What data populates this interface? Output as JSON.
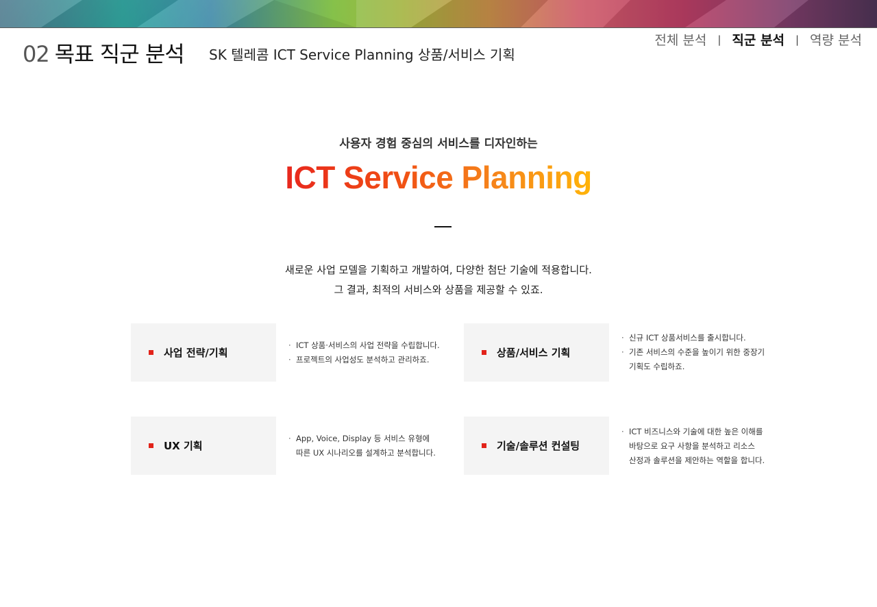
{
  "header": {
    "page_number": "02",
    "page_title": "목표 직군 분석",
    "subtitle": "SK 텔레콤 ICT Service Planning 상품/서비스 기획",
    "nav": [
      {
        "label": "전체 분석",
        "active": false
      },
      {
        "label": "직군 분석",
        "active": true
      },
      {
        "label": "역량 분석",
        "active": false
      }
    ],
    "nav_separator": "|"
  },
  "hero": {
    "kicker": "사용자 경험 중심의 서비스를 디자인하는",
    "title": "ICT Service Planning",
    "description": [
      "새로운 사업 모델을 기획하고 개발하여, 다양한 첨단 기술에 적용합니다.",
      "그 결과, 최적의 서비스와 상품을 제공할 수 있죠."
    ]
  },
  "services": [
    {
      "label": "사업 전략/기획",
      "lines": [
        "ICT 상품·서비스의 사업 전략을 수립합니다.",
        "프로젝트의 사업성도 분석하고 관리하죠."
      ],
      "bullets": [
        true,
        true
      ]
    },
    {
      "label": "상품/서비스 기획",
      "lines": [
        "신규 ICT 상품서비스를 출시합니다.",
        "기존 서비스의 수준을 높이기 위한 중장기",
        "기획도 수립하죠."
      ],
      "bullets": [
        true,
        true,
        false
      ]
    },
    {
      "label": "UX 기획",
      "lines": [
        "App, Voice, Display 등 서비스 유형에",
        "따른 UX 시나리오를 설계하고 분석합니다."
      ],
      "bullets": [
        true,
        false
      ]
    },
    {
      "label": "기술/솔루션 컨설팅",
      "lines": [
        "ICT 비즈니스와 기술에 대한 높은 이해를",
        "바탕으로 요구 사항을 분석하고 리소스",
        "산정과 솔루션을 제안하는 역할을 합니다."
      ],
      "bullets": [
        true,
        false,
        false
      ]
    }
  ],
  "colors": {
    "accent_red": "#e2231a",
    "gradient_start": "#e8281e",
    "gradient_end": "#ffb409",
    "card_bg": "#f4f4f4"
  }
}
